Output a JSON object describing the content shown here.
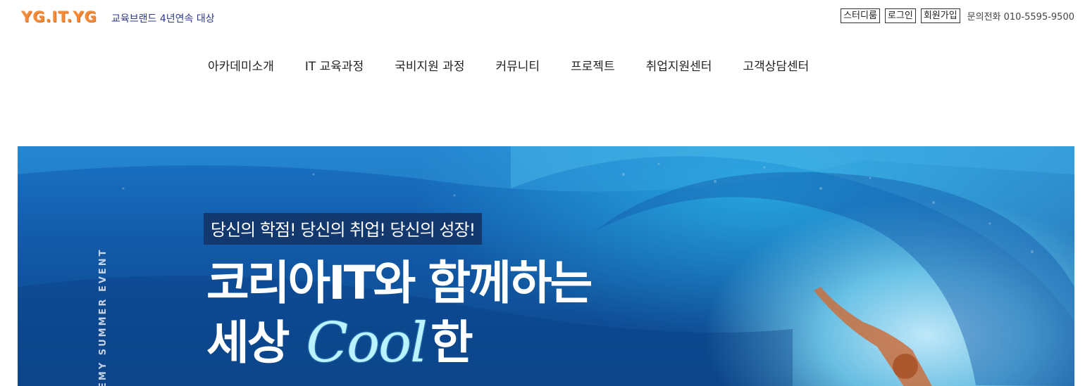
{
  "header": {
    "logo_text": "YG.IT.YG",
    "tagline": "교육브랜드 4년연속 대상",
    "util_links": [
      "스터디룸",
      "로그인",
      "회원가입"
    ],
    "phone": "문의전화 010-5595-9500"
  },
  "nav": {
    "items": [
      "아카데미소개",
      "IT 교육과정",
      "국비지원 과정",
      "커뮤니티",
      "프로젝트",
      "취업지원센터",
      "고객상담센터"
    ]
  },
  "hero": {
    "vertical_text": "EMY SUMMER EVENT",
    "subhead": "당신의 학점! 당신의 취업! 당신의 성장!",
    "headline_line1": "코리아IT와 함께하는",
    "headline_line2_prefix": "세상",
    "headline_line2_script": "Cool",
    "headline_line2_suffix": "한"
  },
  "colors": {
    "logo": "#f28c3a",
    "tagline": "#2d3a8c",
    "hero_dark": "#0e4a8e",
    "hero_light": "#b9f3ff",
    "subhead_bg": "#13386e"
  }
}
